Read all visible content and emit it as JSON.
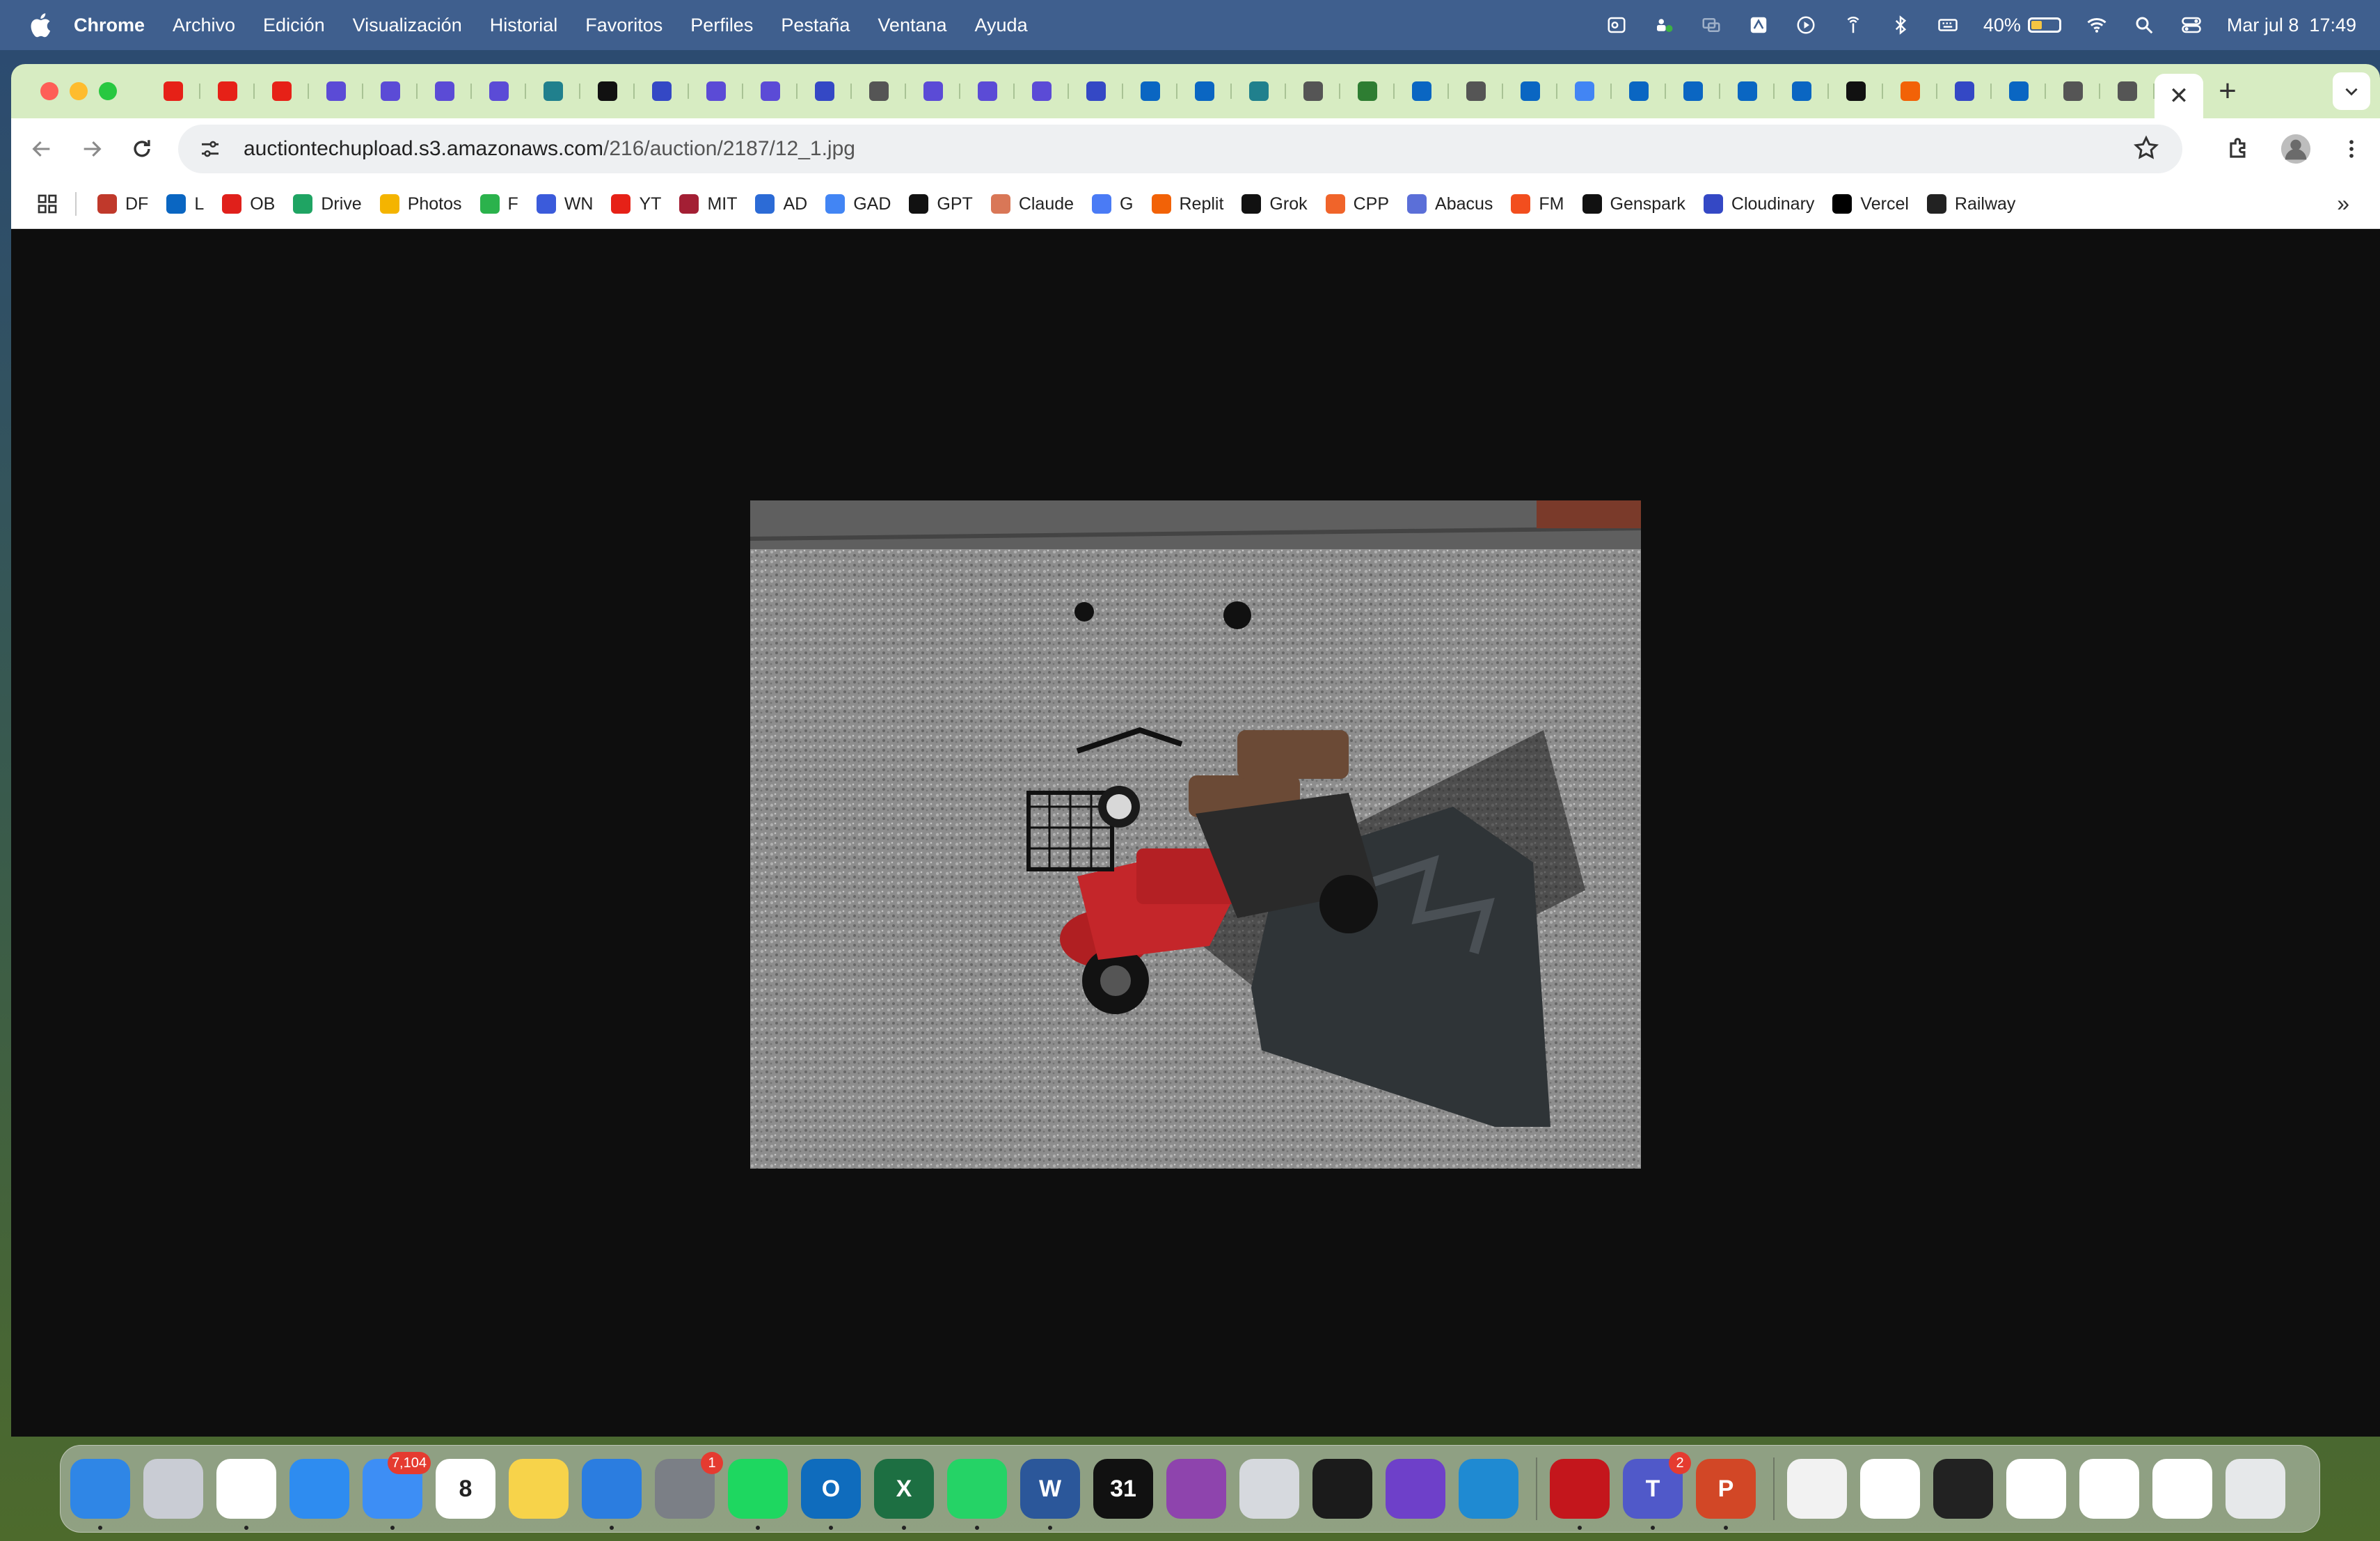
{
  "menubar": {
    "app_name": "Chrome",
    "items": [
      "Archivo",
      "Edición",
      "Visualización",
      "Historial",
      "Favoritos",
      "Perfiles",
      "Pestaña",
      "Ventana",
      "Ayuda"
    ],
    "battery_percent": "40%",
    "battery_level": 0.4,
    "datetime": "Mar jul 8  17:49"
  },
  "tabs": {
    "favicons": [
      "youtube-icon",
      "youtube-icon",
      "youtube-icon",
      "app-icon",
      "app-icon",
      "app-icon",
      "app-icon",
      "perplexity-icon",
      "chatgpt-icon",
      "cloudinary-icon",
      "app-icon",
      "app-icon",
      "cloudinary-icon",
      "globe-icon",
      "app-icon",
      "app-icon",
      "app-icon",
      "cloudinary-icon",
      "linkedin-icon",
      "linkedin-icon",
      "perplexity-icon",
      "globe-icon",
      "chrome-icon",
      "linkedin-icon",
      "globe-icon",
      "linkedin-icon",
      "google-icon",
      "linkedin-icon",
      "linkedin-icon",
      "linkedin-icon",
      "linkedin-icon",
      "chatgpt-icon",
      "replit-icon",
      "cloudinary-icon",
      "linkedin-icon",
      "globe-icon",
      "globe-icon"
    ],
    "active_close": "✕",
    "new_tab": "+"
  },
  "toolbar": {
    "url_host": "auctiontechupload.s3.amazonaws.com",
    "url_path": "/216/auction/2187/12_1.jpg"
  },
  "bookmarks": [
    {
      "label": "DF",
      "icon": "df-icon",
      "color": "#c0392b"
    },
    {
      "label": "L",
      "icon": "linkedin-icon",
      "color": "#0a66c2"
    },
    {
      "label": "OB",
      "icon": "santander-icon",
      "color": "#e0201b"
    },
    {
      "label": "Drive",
      "icon": "drive-icon",
      "color": "#1fa463"
    },
    {
      "label": "Photos",
      "icon": "photos-icon",
      "color": "#f4b400"
    },
    {
      "label": "F",
      "icon": "feedly-icon",
      "color": "#2bb24c"
    },
    {
      "label": "WN",
      "icon": "wn-icon",
      "color": "#3b5bdb"
    },
    {
      "label": "YT",
      "icon": "youtube-icon",
      "color": "#e62117"
    },
    {
      "label": "MIT",
      "icon": "mit-icon",
      "color": "#a31f34"
    },
    {
      "label": "AD",
      "icon": "ad-icon",
      "color": "#2c6bd6"
    },
    {
      "label": "GAD",
      "icon": "google-icon",
      "color": "#4285f4"
    },
    {
      "label": "GPT",
      "icon": "chatgpt-icon",
      "color": "#111111"
    },
    {
      "label": "Claude",
      "icon": "claude-icon",
      "color": "#d97757"
    },
    {
      "label": "G",
      "icon": "gemini-icon",
      "color": "#4a7bf5"
    },
    {
      "label": "Replit",
      "icon": "replit-icon",
      "color": "#f26207"
    },
    {
      "label": "Grok",
      "icon": "grok-icon",
      "color": "#111111"
    },
    {
      "label": "CPP",
      "icon": "cpp-icon",
      "color": "#f0642a"
    },
    {
      "label": "Abacus",
      "icon": "abacus-icon",
      "color": "#5b6fd8"
    },
    {
      "label": "FM",
      "icon": "figma-icon",
      "color": "#f24e1e"
    },
    {
      "label": "Genspark",
      "icon": "genspark-icon",
      "color": "#111111"
    },
    {
      "label": "Cloudinary",
      "icon": "cloudinary-icon",
      "color": "#3448c5"
    },
    {
      "label": "Vercel",
      "icon": "vercel-icon",
      "color": "#000000"
    },
    {
      "label": "Railway",
      "icon": "railway-icon",
      "color": "#222222"
    }
  ],
  "bookmarks_overflow": "»",
  "dock": [
    {
      "name": "finder",
      "color": "#2f86e6",
      "glyph": "",
      "badge": "",
      "running": true
    },
    {
      "name": "launchpad",
      "color": "#c9ccd4",
      "glyph": "",
      "badge": "",
      "running": false
    },
    {
      "name": "chrome",
      "color": "#ffffff",
      "glyph": "",
      "badge": "",
      "running": true
    },
    {
      "name": "safari",
      "color": "#2e8cf0",
      "glyph": "",
      "badge": "",
      "running": false
    },
    {
      "name": "mail",
      "color": "#3d8ef5",
      "glyph": "",
      "badge": "7,104",
      "running": true
    },
    {
      "name": "calendar",
      "color": "#ffffff",
      "glyph": "8",
      "badge": "",
      "running": false
    },
    {
      "name": "notes",
      "color": "#f7d34a",
      "glyph": "",
      "badge": "",
      "running": false
    },
    {
      "name": "keynote",
      "color": "#2b7de0",
      "glyph": "",
      "badge": "",
      "running": true
    },
    {
      "name": "system-settings",
      "color": "#7b7f86",
      "glyph": "",
      "badge": "1",
      "running": false
    },
    {
      "name": "spotify",
      "color": "#1ed760",
      "glyph": "",
      "badge": "",
      "running": true
    },
    {
      "name": "outlook",
      "color": "#0f6cbd",
      "glyph": "O",
      "badge": "",
      "running": true
    },
    {
      "name": "excel",
      "color": "#1d6f42",
      "glyph": "X",
      "badge": "",
      "running": true
    },
    {
      "name": "whatsapp",
      "color": "#25d366",
      "glyph": "",
      "badge": "",
      "running": true
    },
    {
      "name": "word",
      "color": "#2b579a",
      "glyph": "W",
      "badge": "",
      "running": true
    },
    {
      "name": "calendar-31",
      "color": "#111111",
      "glyph": "31",
      "badge": "",
      "running": false
    },
    {
      "name": "screen-recorder",
      "color": "#8e44ad",
      "glyph": "",
      "badge": "",
      "running": false
    },
    {
      "name": "iphone-mirroring",
      "color": "#d6d9de",
      "glyph": "",
      "badge": "",
      "running": false
    },
    {
      "name": "dashlane",
      "color": "#1b1b1b",
      "glyph": "",
      "badge": "",
      "running": false
    },
    {
      "name": "github-desktop",
      "color": "#6e40c9",
      "glyph": "",
      "badge": "",
      "running": false
    },
    {
      "name": "vscode",
      "color": "#1f8ad2",
      "glyph": "",
      "badge": "",
      "running": false
    },
    {
      "name": "acrobat",
      "color": "#c4161c",
      "glyph": "",
      "badge": "",
      "running": true
    },
    {
      "name": "teams",
      "color": "#5059c9",
      "glyph": "T",
      "badge": "2",
      "running": true
    },
    {
      "name": "powerpoint",
      "color": "#d24726",
      "glyph": "P",
      "badge": "",
      "running": true
    },
    {
      "name": "pdf-file",
      "color": "#f2f2f2",
      "glyph": "",
      "badge": "",
      "running": false
    },
    {
      "name": "stack-doc-1",
      "color": "#ffffff",
      "glyph": "",
      "badge": "",
      "running": false
    },
    {
      "name": "stack-terminal",
      "color": "#222222",
      "glyph": "",
      "badge": "",
      "running": false
    },
    {
      "name": "stack-doc-2",
      "color": "#ffffff",
      "glyph": "",
      "badge": "",
      "running": false
    },
    {
      "name": "stack-doc-3",
      "color": "#ffffff",
      "glyph": "",
      "badge": "",
      "running": false
    },
    {
      "name": "stack-doc-4",
      "color": "#ffffff",
      "glyph": "",
      "badge": "",
      "running": false
    },
    {
      "name": "trash",
      "color": "#e6e8ea",
      "glyph": "",
      "badge": "",
      "running": false
    }
  ]
}
